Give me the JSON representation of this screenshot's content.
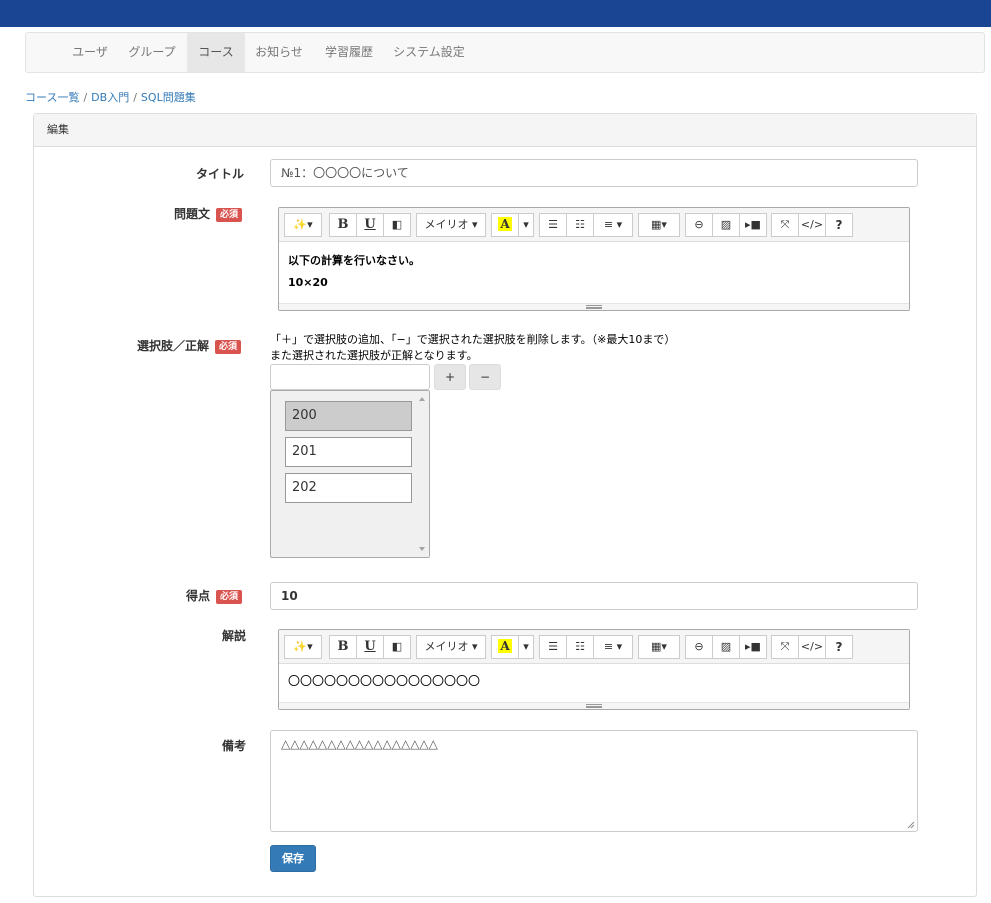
{
  "nav": {
    "items": [
      {
        "label": "ユーザ"
      },
      {
        "label": "グループ"
      },
      {
        "label": "コース"
      },
      {
        "label": "お知らせ"
      },
      {
        "label": "学習履歴"
      },
      {
        "label": "システム設定"
      }
    ],
    "active": "コース"
  },
  "breadcrumb": {
    "items": [
      "コース一覧",
      "DB入門",
      "SQL問題集"
    ],
    "separator": "/"
  },
  "panel": {
    "title": "編集"
  },
  "form": {
    "required_badge": "必須",
    "title": {
      "label": "タイトル",
      "value": "№1：〇〇〇〇について"
    },
    "question": {
      "label": "問題文",
      "lines": [
        "以下の計算を行いなさい。",
        "10×20"
      ]
    },
    "choices": {
      "label": "選択肢／正解",
      "hint1": "「＋」で選択肢の追加、「−」で選択された選択肢を削除します。（※最大10まで）",
      "hint2": "また選択された選択肢が正解となります。",
      "input_value": "",
      "add_label": "+",
      "remove_label": "−",
      "items": [
        "200",
        "201",
        "202"
      ],
      "selected_index": 0
    },
    "score": {
      "label": "得点",
      "value": "10"
    },
    "explanation": {
      "label": "解説",
      "text": "〇〇〇〇〇〇〇〇〇〇〇〇〇〇〇〇"
    },
    "notes": {
      "label": "備考",
      "text": "△△△△△△△△△△△△△△△△△"
    },
    "save_label": "保存"
  },
  "editor_toolbar": {
    "font_name": "メイリオ",
    "bold": "B",
    "underline": "U",
    "color_letter": "A",
    "help": "?"
  },
  "colors": {
    "topbar": "#1a4592",
    "required": "#d9534f",
    "primary": "#337ab7",
    "link": "#337ab7"
  }
}
